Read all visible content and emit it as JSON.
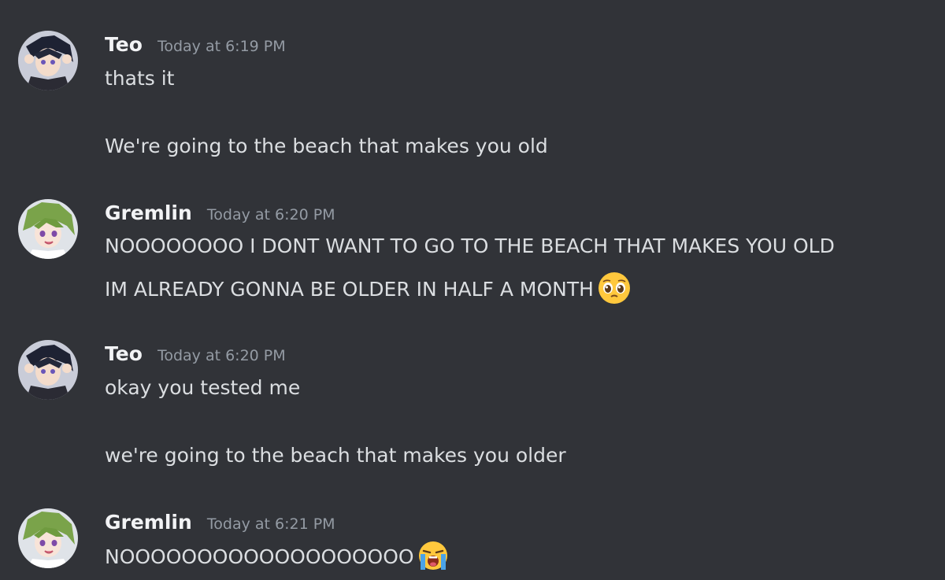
{
  "messages": [
    {
      "author": "Teo",
      "timestamp": "Today at 6:19 PM",
      "avatar_icon": "teo-avatar-icon",
      "lines": [
        "thats it",
        "We're going to the beach that makes you old"
      ]
    },
    {
      "author": "Gremlin",
      "timestamp": "Today at 6:20 PM",
      "avatar_icon": "gremlin-avatar-icon",
      "lines": [
        "NOOOOOOOO I DONT WANT TO GO TO THE BEACH THAT MAKES YOU OLD",
        "IM ALREADY GONNA BE OLDER IN HALF A MONTH"
      ],
      "emoji": "pleading-face-emoji"
    },
    {
      "author": "Teo",
      "timestamp": "Today at 6:20 PM",
      "avatar_icon": "teo-avatar-icon",
      "lines": [
        "okay you tested me",
        "we're going to the beach that makes you older"
      ]
    },
    {
      "author": "Gremlin",
      "timestamp": "Today at 6:21 PM",
      "avatar_icon": "gremlin-avatar-icon",
      "lines": [
        "NOOOOOOOOOOOOOOOOOOO"
      ],
      "emoji": "loudly-crying-face-emoji"
    }
  ],
  "colors": {
    "background": "#313338",
    "username": "#f2f3f5",
    "timestamp": "#949ba4",
    "text": "#dbdee1"
  }
}
